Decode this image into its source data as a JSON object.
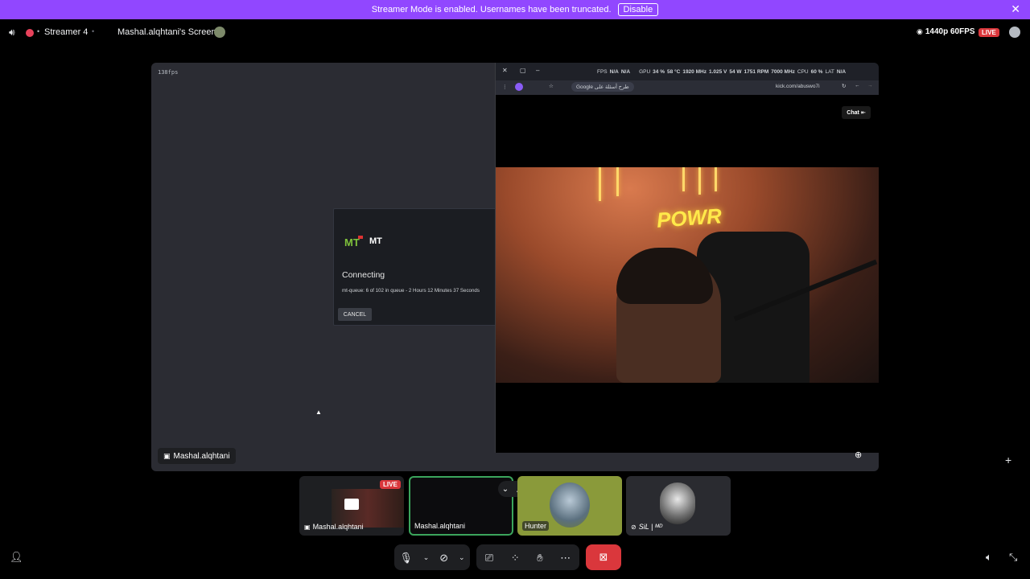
{
  "banner": {
    "message": "Streamer Mode is enabled. Usernames have been truncated.",
    "button": "Disable"
  },
  "header": {
    "channel": "Streamer 4",
    "screen_title": "Mashal.alqhtani's Screen",
    "quality": "1440p 60FPS",
    "live": "LIVE"
  },
  "stage": {
    "fps": "138fps",
    "dialog": {
      "app": "MT",
      "status": "Connecting",
      "queue": "mt-queue: 6 of 102 in queue - 2 Hours 12 Minutes 37 Seconds",
      "cancel": "CANCEL"
    },
    "browser": {
      "overlay": {
        "fps_label": "FPS",
        "fps_value": "N/A",
        "fps_value2": "N/A",
        "gpu": "GPU",
        "gpu_load": "34 %",
        "gpu_temp": "58 °C",
        "gpu_clock": "1920 MHz",
        "gpu_volt": "1.025 V",
        "gpu_power": "54 W",
        "gpu_fan": "1751 RPM",
        "mem_clock": "7000 MHz",
        "cpu": "CPU",
        "cpu_load": "60 %",
        "lat": "LAT",
        "lat_value": "N/A"
      },
      "search_pill": "Google طرح أسئلة على",
      "url": "kick.com/abuswo7i",
      "chat_button": "Chat",
      "stream_sign": "POWR"
    },
    "nameplate": "Mashal.alqhtani"
  },
  "participants": [
    {
      "name": "Mashal.alqhtani",
      "live": "LIVE"
    },
    {
      "name": "Mashal.alqhtani"
    },
    {
      "name": "Hunter"
    },
    {
      "name": "SiL | ᴹᴰ"
    }
  ],
  "colors": {
    "brand": "#9147ff",
    "live": "#da373c",
    "hangup": "#da373c",
    "tile_active": "#3ba55c"
  }
}
